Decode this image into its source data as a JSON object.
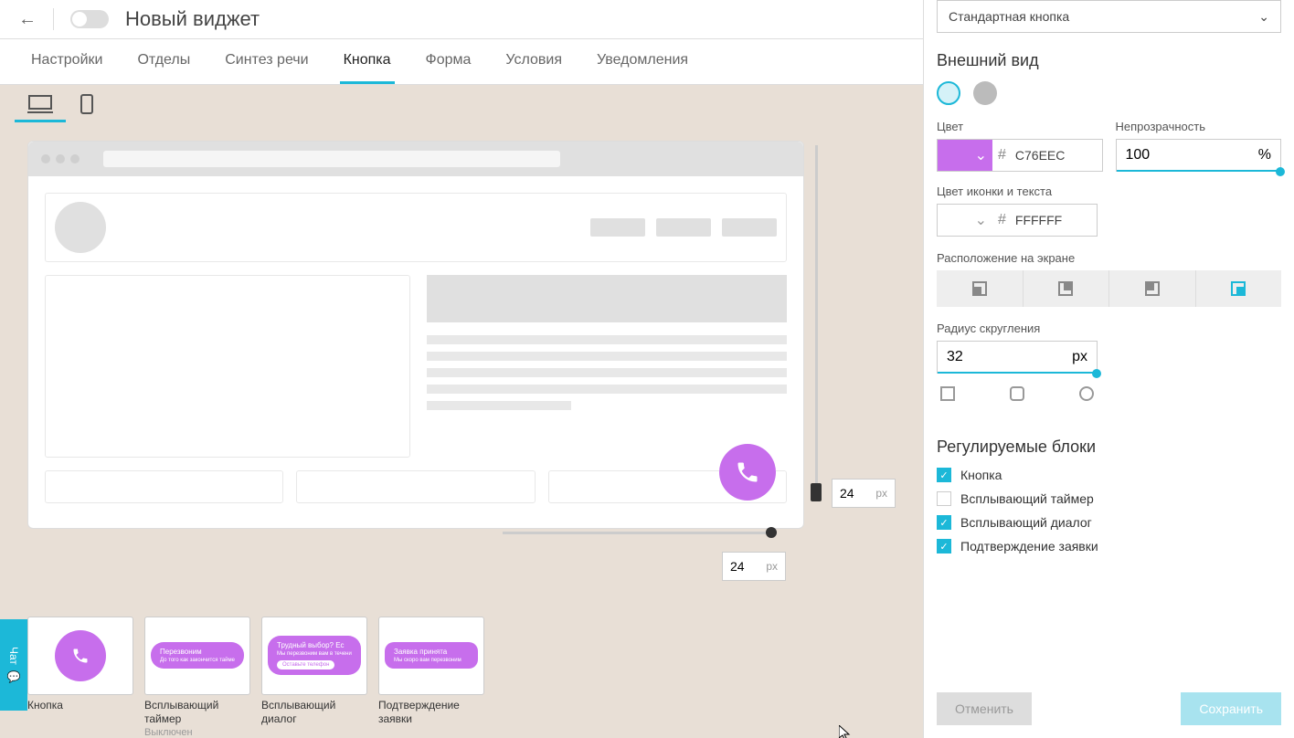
{
  "header": {
    "title": "Новый виджет"
  },
  "tabs": {
    "items": [
      "Настройки",
      "Отделы",
      "Синтез речи",
      "Кнопка",
      "Форма",
      "Условия",
      "Уведомления"
    ],
    "active_index": 3
  },
  "margins": {
    "vertical": "24",
    "vertical_unit": "px",
    "horizontal": "24",
    "horizontal_unit": "px"
  },
  "thumbs": [
    {
      "label": "Кнопка",
      "sub": ""
    },
    {
      "label": "Всплывающий таймер",
      "sub": "Выключен",
      "bubble": "Перезвоним",
      "bubble_sub": "До того как закончится тайме"
    },
    {
      "label": "Всплывающий диалог",
      "sub": "",
      "bubble": "Трудный выбор? Ес",
      "bubble_sub": "Мы перезвоним вам в течени",
      "btn": "Оставьте телефон"
    },
    {
      "label": "Подтверждение заявки",
      "sub": "",
      "bubble": "Заявка принята",
      "bubble_sub": "Мы скоро вам перезвоним"
    }
  ],
  "sidebar": {
    "type_select": "Стандартная кнопка",
    "section_appearance": "Внешний вид",
    "color_label": "Цвет",
    "color_value": "C76EEC",
    "opacity_label": "Непрозрачность",
    "opacity_value": "100",
    "opacity_unit": "%",
    "icon_color_label": "Цвет иконки и текста",
    "icon_color_value": "FFFFFF",
    "position_label": "Расположение на экране",
    "radius_label": "Радиус скругления",
    "radius_value": "32",
    "radius_unit": "px",
    "blocks_section": "Регулируемые блоки",
    "blocks": [
      {
        "label": "Кнопка",
        "checked": true
      },
      {
        "label": "Всплывающий таймер",
        "checked": false
      },
      {
        "label": "Всплывающий диалог",
        "checked": true
      },
      {
        "label": "Подтверждение заявки",
        "checked": true
      }
    ],
    "cancel": "Отменить",
    "save": "Сохранить"
  },
  "chat_label": "Чат"
}
